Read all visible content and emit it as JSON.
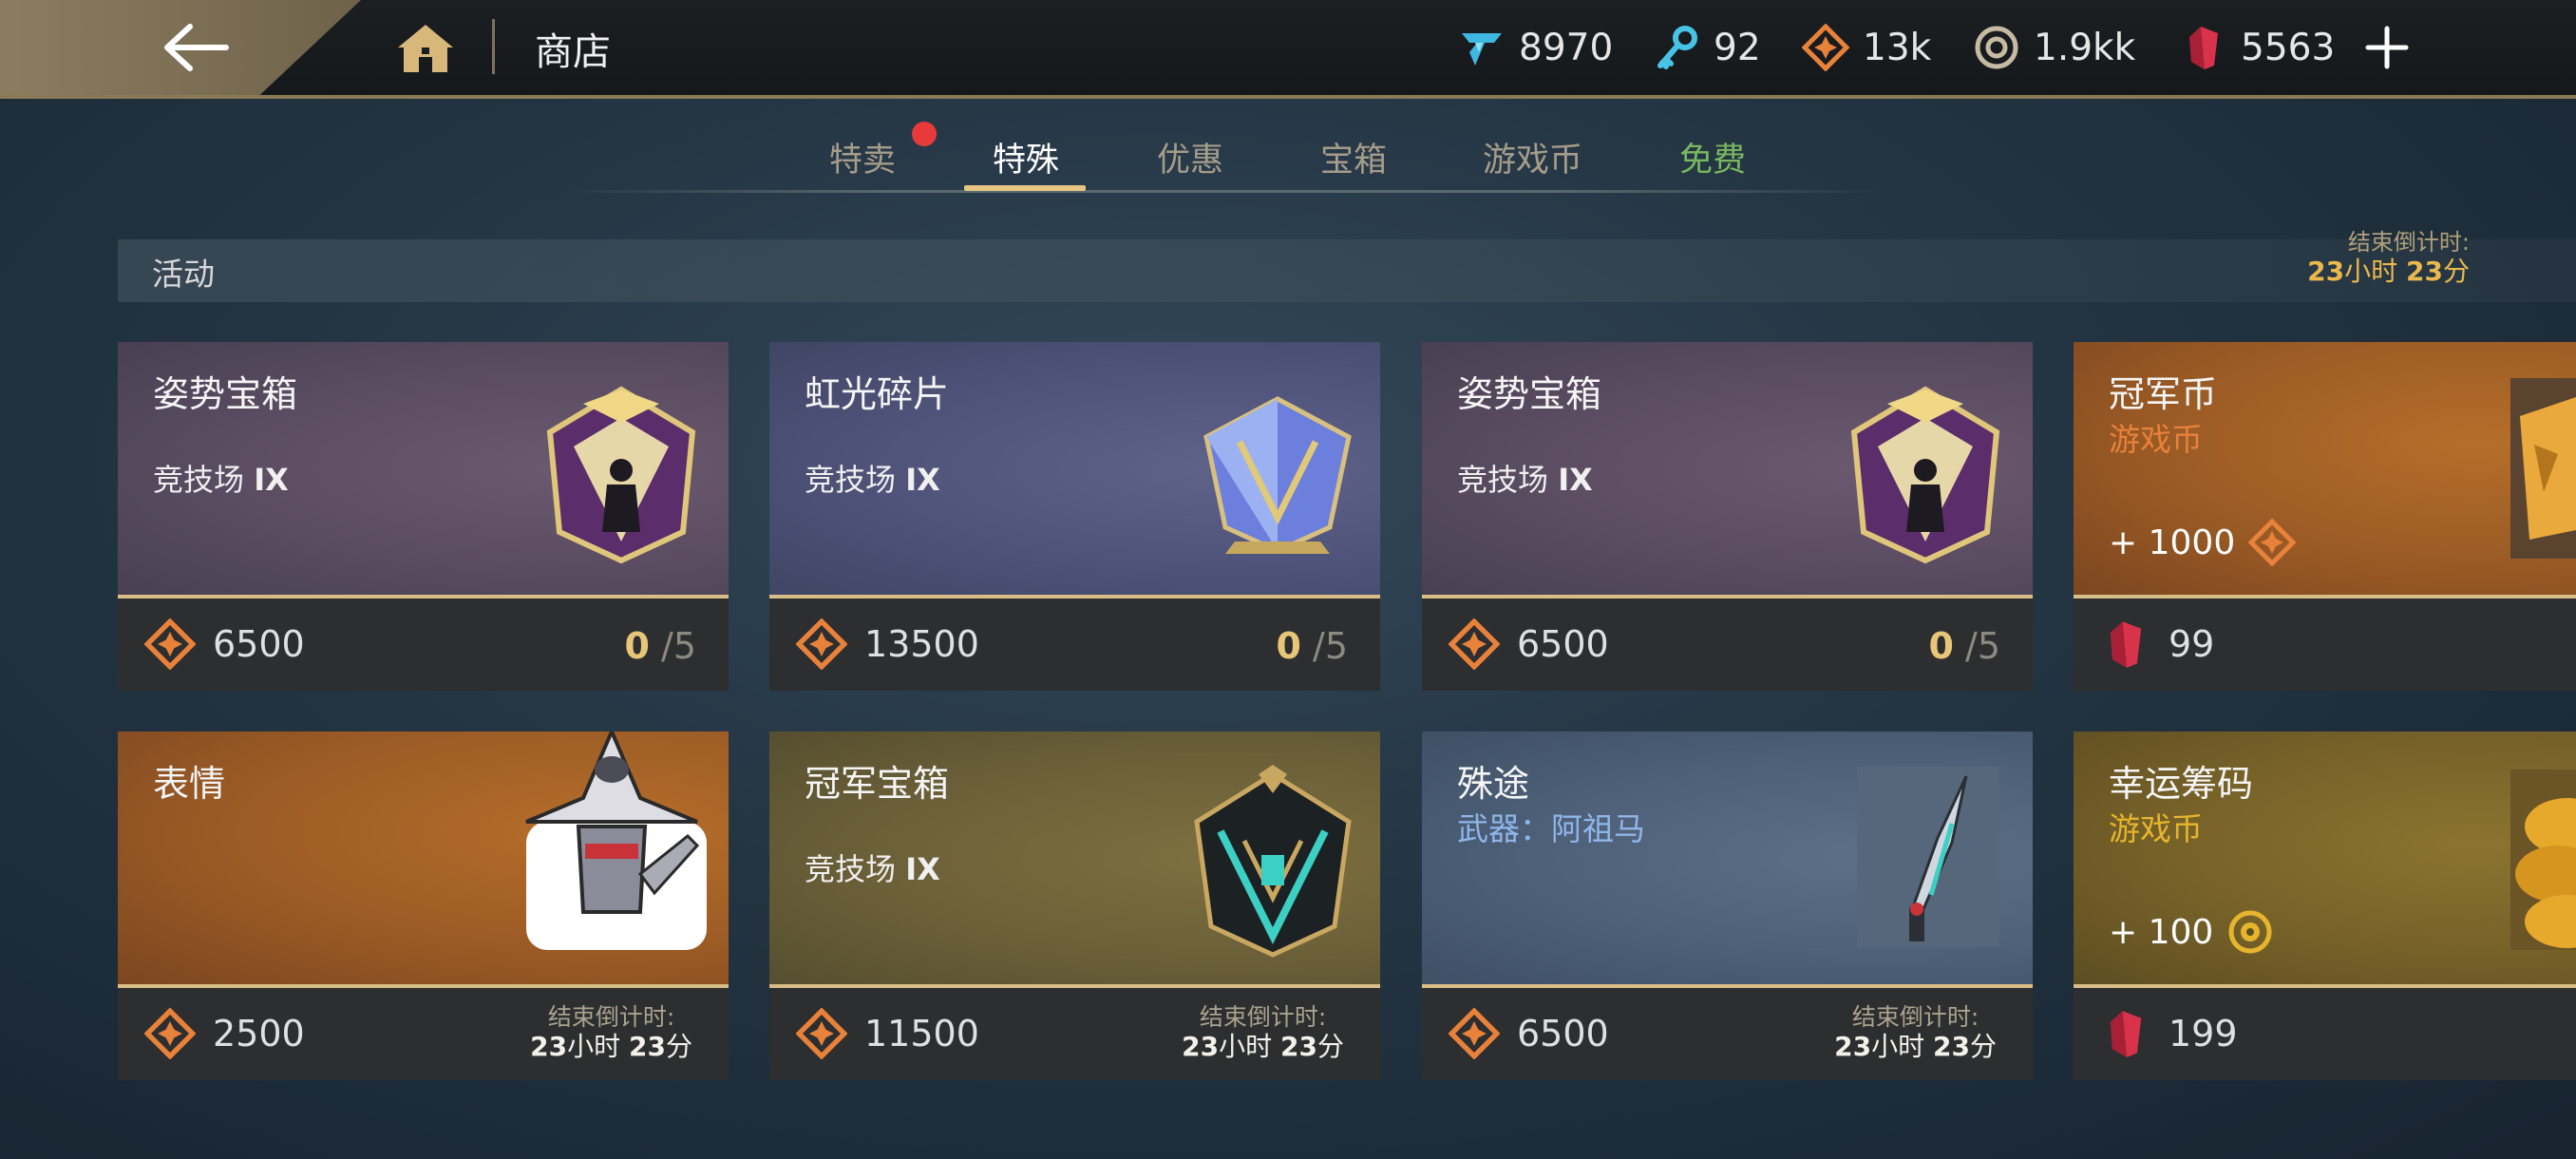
{
  "header": {
    "title": "商店",
    "currencies": [
      {
        "icon": "gem-icon",
        "value": "8970"
      },
      {
        "icon": "key-icon",
        "value": "92"
      },
      {
        "icon": "arena-token-icon",
        "value": "13k"
      },
      {
        "icon": "coin-icon",
        "value": "1.9kk"
      },
      {
        "icon": "ruby-icon",
        "value": "5563"
      }
    ]
  },
  "tabs": [
    {
      "label": "特卖"
    },
    {
      "label": "特殊"
    },
    {
      "label": "优惠"
    },
    {
      "label": "宝箱"
    },
    {
      "label": "游戏币"
    },
    {
      "label": "免费"
    }
  ],
  "section": {
    "title": "活动",
    "countdown_label": "结束倒计时:",
    "countdown_h": "23",
    "countdown_h_unit": "小时",
    "countdown_m": "23",
    "countdown_m_unit": "分"
  },
  "cards": [
    {
      "name": "姿势宝箱",
      "sub": "竞技场",
      "tier": "IX",
      "price": "6500",
      "bought": "0",
      "limit": "/5"
    },
    {
      "name": "虹光碎片",
      "sub": "竞技场",
      "tier": "IX",
      "price": "13500",
      "bought": "0",
      "limit": "/5"
    },
    {
      "name": "姿势宝箱",
      "sub": "竞技场",
      "tier": "IX",
      "price": "6500",
      "bought": "0",
      "limit": "/5"
    },
    {
      "name": "冠军币",
      "sub": "游戏币",
      "amount": "+ 1000",
      "price": "99"
    },
    {
      "name": "表情",
      "price": "2500",
      "countdown_label": "结束倒计时:",
      "countdown_h": "23",
      "countdown_h_unit": "小时",
      "countdown_m": "23",
      "countdown_m_unit": "分"
    },
    {
      "name": "冠军宝箱",
      "sub": "竞技场",
      "tier": "IX",
      "price": "11500",
      "countdown_label": "结束倒计时:",
      "countdown_h": "23",
      "countdown_h_unit": "小时",
      "countdown_m": "23",
      "countdown_m_unit": "分"
    },
    {
      "name": "殊途",
      "sub": "武器：阿祖马",
      "price": "6500",
      "countdown_label": "结束倒计时:",
      "countdown_h": "23",
      "countdown_h_unit": "小时",
      "countdown_m": "23",
      "countdown_m_unit": "分"
    },
    {
      "name": "幸运筹码",
      "sub": "游戏币",
      "amount": "+ 100",
      "price": "199"
    }
  ],
  "colors": {
    "accent_gold": "#e6c583",
    "tab_free_green": "#79b860",
    "notification_red": "#e83a3a",
    "countdown_orange": "#e9b94e",
    "currency_orange_text": "#e8813a",
    "currency_yellow_text": "#e6b52e",
    "weapon_blue_text": "#8fb6ea"
  }
}
